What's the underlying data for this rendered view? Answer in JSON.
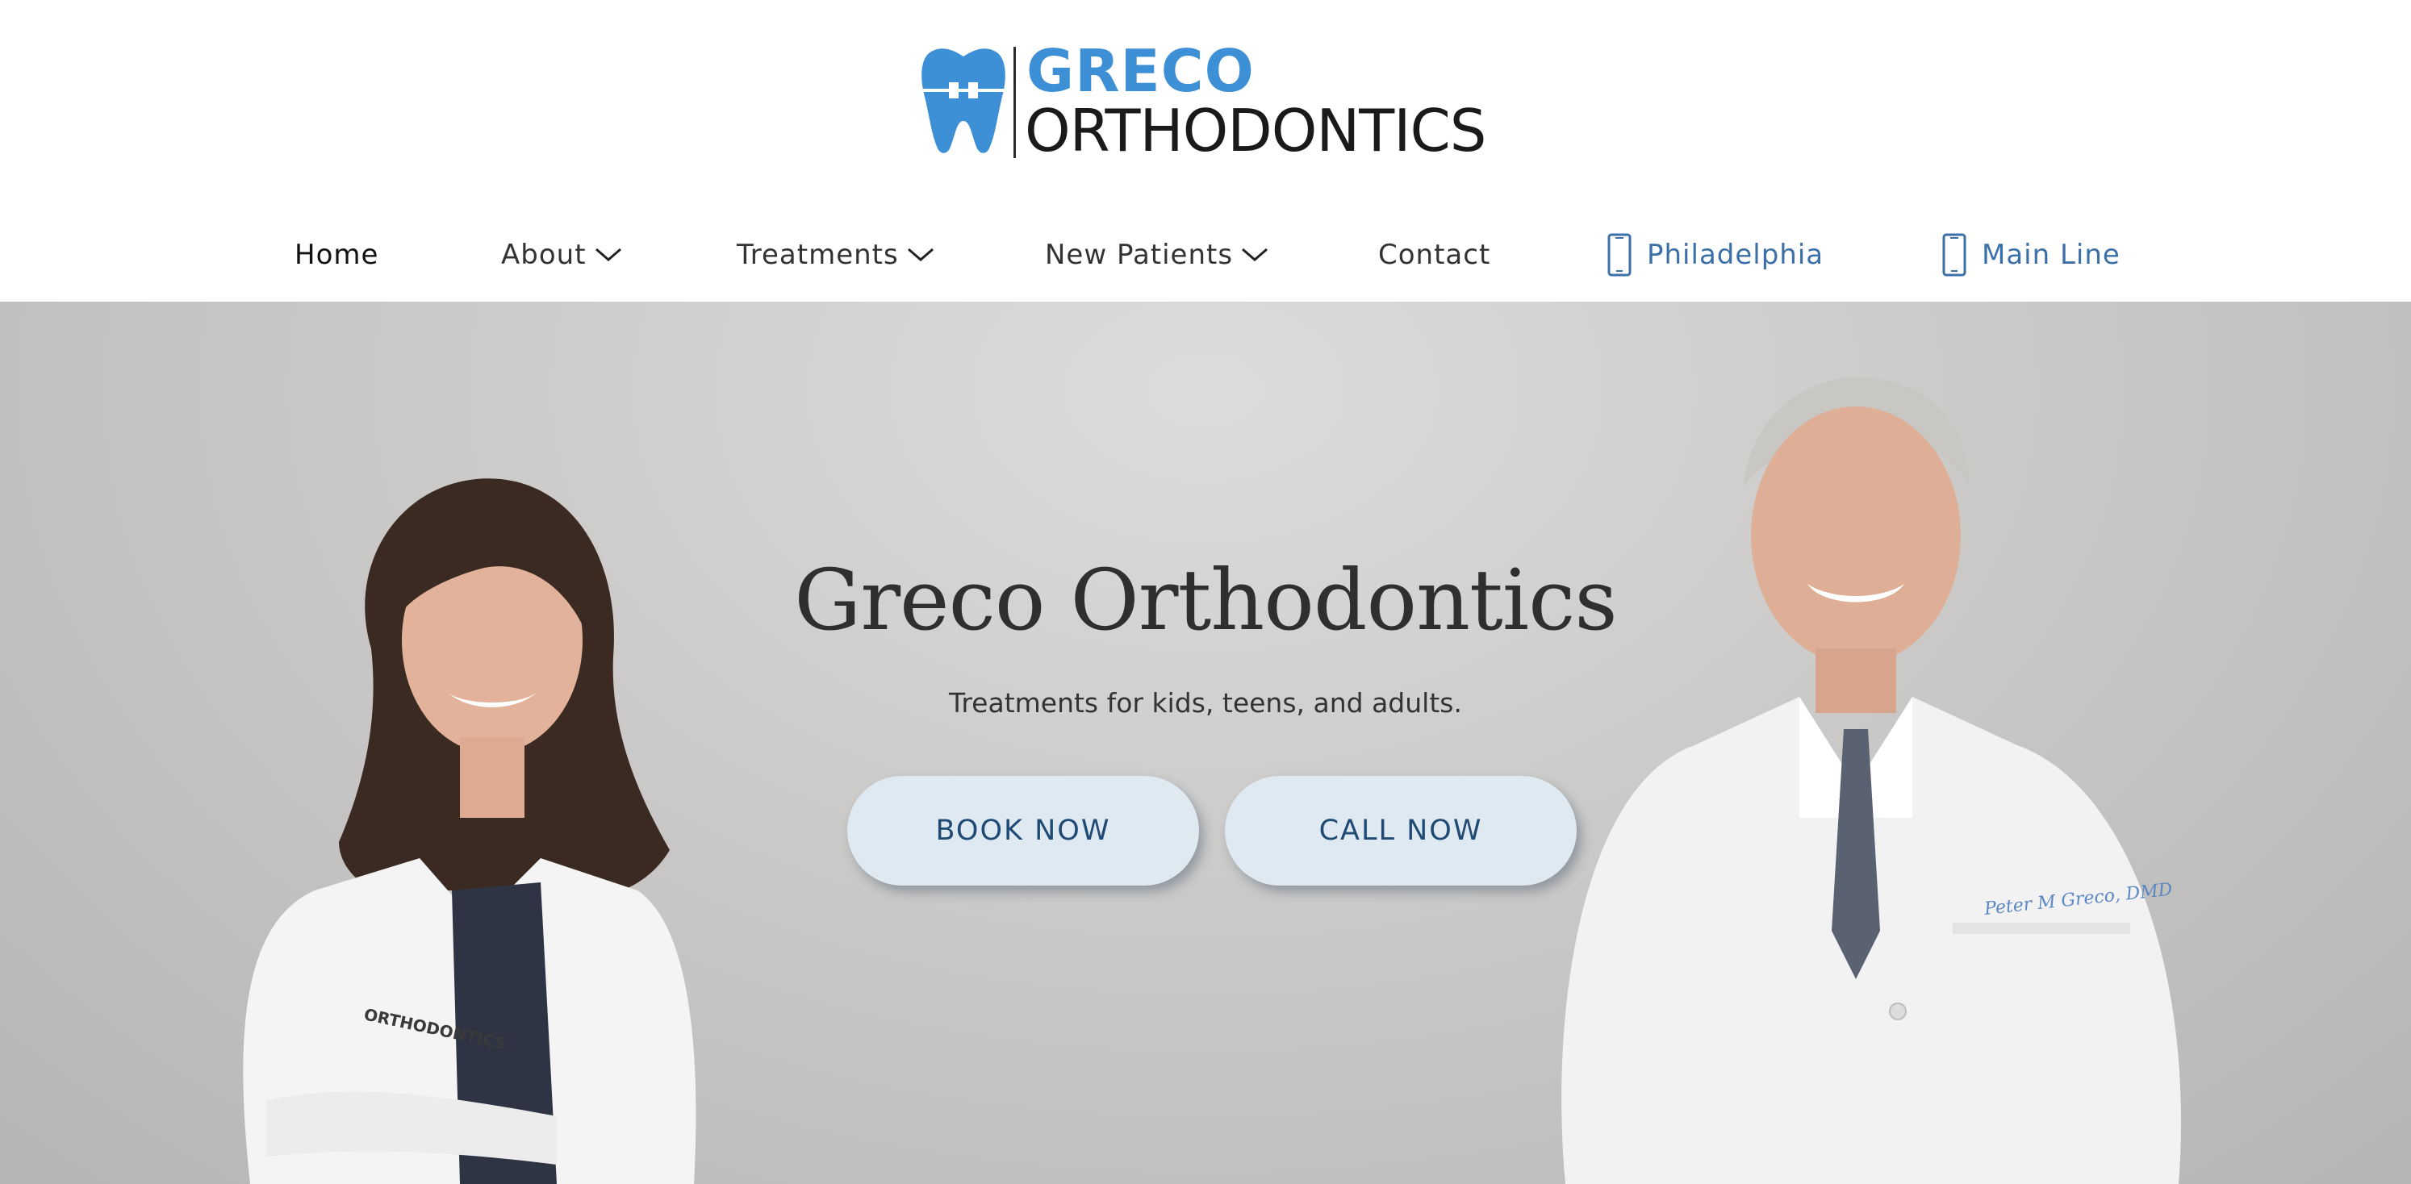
{
  "brand": {
    "line1": "GRECO",
    "line2": "ORTHODONTICS",
    "colors": {
      "primary": "#3d8fd6",
      "text": "#1a1a1a"
    },
    "logo_icon": "tooth-with-brace-icon"
  },
  "nav": {
    "items": [
      {
        "label": "Home",
        "active": true,
        "dropdown": false
      },
      {
        "label": "About",
        "dropdown": true
      },
      {
        "label": "Treatments",
        "dropdown": true
      },
      {
        "label": "New Patients",
        "dropdown": true
      },
      {
        "label": "Contact",
        "dropdown": false
      }
    ],
    "phones": [
      {
        "label": "Philadelphia",
        "icon": "phone-icon"
      },
      {
        "label": "Main Line",
        "icon": "phone-icon"
      }
    ],
    "colors": {
      "link": "#333333",
      "phone": "#3b6fa8"
    }
  },
  "hero": {
    "title": "Greco Orthodontics",
    "subtitle": "Treatments for kids, teens, and adults.",
    "buttons": {
      "book": "BOOK NOW",
      "call": "CALL NOW"
    },
    "coat_logo_text": "ORTHODONTICS",
    "coat_signature": "Peter M Greco, DMD",
    "colors": {
      "button_bg": "#dfe9f1",
      "button_text": "#1f4a74"
    }
  }
}
